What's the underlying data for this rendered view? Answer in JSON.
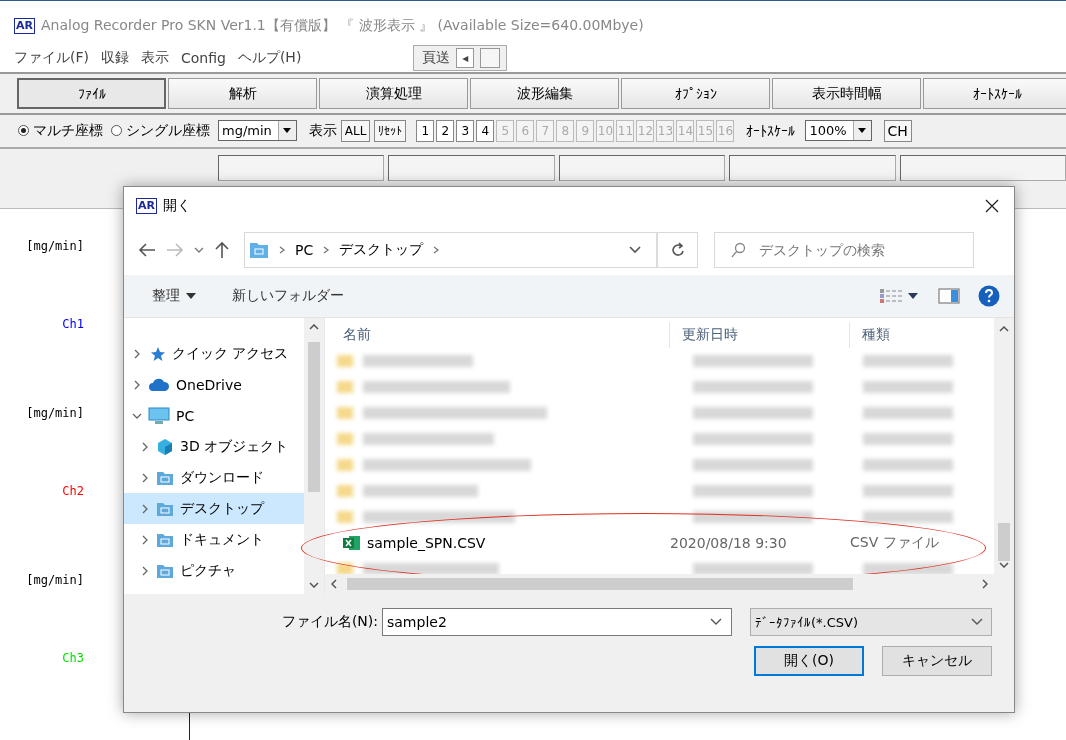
{
  "window": {
    "title": "Analog Recorder Pro SKN Ver1.1【有償版】 『 波形表示 』 (Available Size=640.00Mbye)",
    "app_icon": "AR"
  },
  "menu": [
    "ファイル(F)",
    "収録",
    "表示",
    "Config",
    "ヘルプ(H)"
  ],
  "page_feed": {
    "label": "頁送",
    "arrow": "◂"
  },
  "toolbar": [
    {
      "label": "ﾌｧｲﾙ",
      "selected": true
    },
    {
      "label": "解析",
      "selected": false
    },
    {
      "label": "演算処理",
      "selected": false
    },
    {
      "label": "波形編集",
      "selected": false
    },
    {
      "label": "ｵﾌﾟｼｮﾝ",
      "selected": false
    },
    {
      "label": "表示時間幅",
      "selected": false
    },
    {
      "label": "ｵｰﾄｽｹｰﾙ",
      "selected": false
    }
  ],
  "options": {
    "radios": [
      {
        "label": "マルチ座標",
        "selected": true
      },
      {
        "label": "シングル座標",
        "selected": false
      }
    ],
    "unit": "mg/min",
    "show_label": "表示",
    "all": "ALL",
    "reset": "ﾘｾｯﾄ",
    "channels": [
      {
        "label": "1",
        "disabled": false
      },
      {
        "label": "2",
        "disabled": false
      },
      {
        "label": "3",
        "disabled": false
      },
      {
        "label": "4",
        "disabled": false
      },
      {
        "label": "5",
        "disabled": true
      },
      {
        "label": "6",
        "disabled": true
      },
      {
        "label": "7",
        "disabled": true
      },
      {
        "label": "8",
        "disabled": true
      },
      {
        "label": "9",
        "disabled": true
      },
      {
        "label": "10",
        "disabled": true
      },
      {
        "label": "11",
        "disabled": true
      },
      {
        "label": "12",
        "disabled": true
      },
      {
        "label": "13",
        "disabled": true
      },
      {
        "label": "14",
        "disabled": true
      },
      {
        "label": "15",
        "disabled": true
      },
      {
        "label": "16",
        "disabled": true
      }
    ],
    "autoscale_label": "ｵｰﾄｽｹｰﾙ",
    "autoscale": "100%",
    "ch_button": "CH"
  },
  "plot": [
    {
      "unit": "[mg/min]",
      "channel": "Ch1",
      "color": "#0000ff"
    },
    {
      "unit": "[mg/min]",
      "channel": "Ch2",
      "color": "#ff0000"
    },
    {
      "unit": "[mg/min]",
      "channel": "Ch3",
      "color": "#00e000"
    }
  ],
  "dialog": {
    "icon": "AR",
    "title": "開く",
    "address": [
      "PC",
      "デスクトップ"
    ],
    "search": {
      "placeholder": "デスクトップの検索"
    },
    "commands": {
      "organize": "整理",
      "new_folder": "新しいフォルダー"
    },
    "tree": [
      {
        "label": "クイック アクセス",
        "kind": "quick",
        "expanded": false,
        "selected": false
      },
      {
        "label": "OneDrive",
        "kind": "cloud",
        "expanded": false,
        "selected": false
      },
      {
        "label": "PC",
        "kind": "pc",
        "expanded": true,
        "selected": false,
        "children": [
          {
            "label": "3D オブジェクト",
            "kind": "cube",
            "expanded": false,
            "selected": false
          },
          {
            "label": "ダウンロード",
            "kind": "folder",
            "expanded": false,
            "selected": false
          },
          {
            "label": "デスクトップ",
            "kind": "folder",
            "expanded": false,
            "selected": true
          },
          {
            "label": "ドキュメント",
            "kind": "folder",
            "expanded": false,
            "selected": false
          },
          {
            "label": "ピクチャ",
            "kind": "folder",
            "expanded": false,
            "selected": false
          }
        ]
      }
    ],
    "columns": [
      "名前",
      "更新日時",
      "種類"
    ],
    "files": [
      {
        "kind": "obscured"
      },
      {
        "kind": "obscured"
      },
      {
        "kind": "obscured"
      },
      {
        "kind": "obscured"
      },
      {
        "kind": "obscured"
      },
      {
        "kind": "obscured"
      },
      {
        "kind": "obscured"
      },
      {
        "kind": "file",
        "name": "sample_SPN.CSV",
        "date": "2020/08/18 9:30",
        "type": "CSV ファイル",
        "highlighted": true
      },
      {
        "kind": "obscured"
      }
    ],
    "filename_label": "ファイル名(N):",
    "filename": "sample2",
    "filter": "ﾃﾞｰﾀﾌｧｲﾙ(*.CSV)",
    "open": "開く(O)",
    "cancel": "キャンセル"
  }
}
